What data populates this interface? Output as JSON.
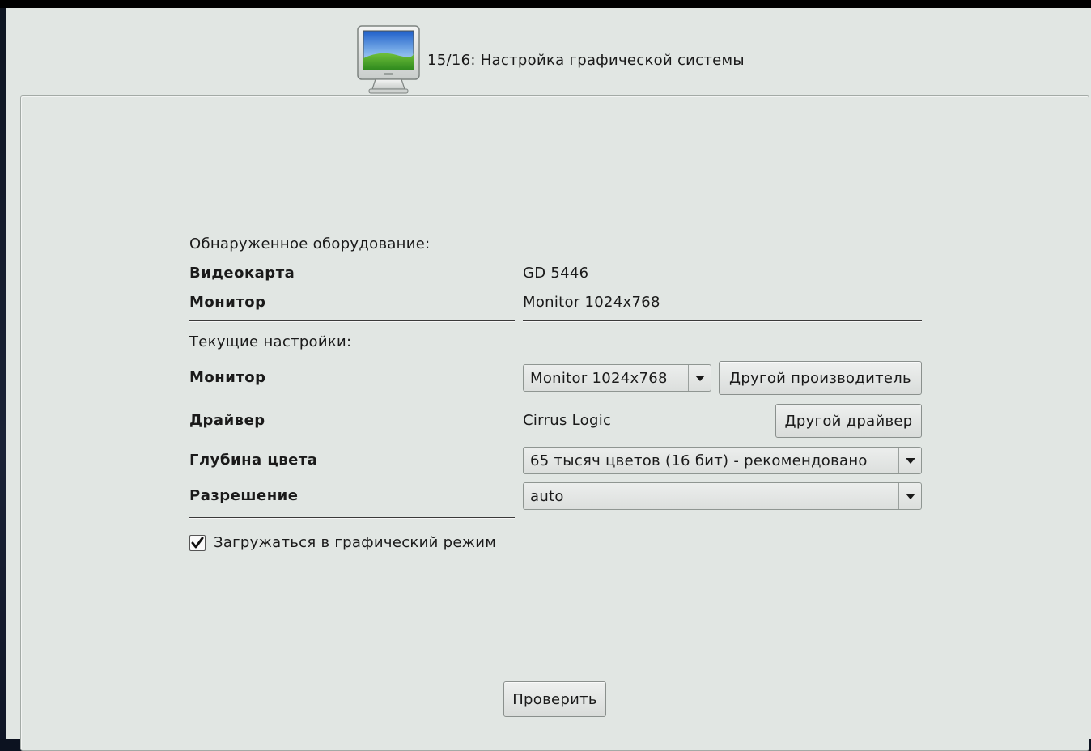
{
  "header": {
    "title": "15/16: Настройка графической системы",
    "icon": "monitor-icon"
  },
  "detected": {
    "section_label": "Обнаруженное оборудование:",
    "video_card_label": "Видеокарта",
    "video_card_value": "GD 5446",
    "monitor_label": "Монитор",
    "monitor_value": "Monitor 1024x768"
  },
  "current": {
    "section_label": "Текущие настройки:",
    "monitor_label": "Монитор",
    "monitor_select": "Monitor 1024x768",
    "other_vendor_button": "Другой производитель",
    "driver_label": "Драйвер",
    "driver_value": "Cirrus Logic",
    "other_driver_button": "Другой драйвер",
    "color_depth_label": "Глубина цвета",
    "color_depth_select": "65 тысяч цветов (16 бит) - рекомендовано",
    "resolution_label": "Разрешение",
    "resolution_select": "auto"
  },
  "boot_graphical": {
    "label": "Загружаться в графический режим",
    "checked": true
  },
  "test_button": "Проверить"
}
